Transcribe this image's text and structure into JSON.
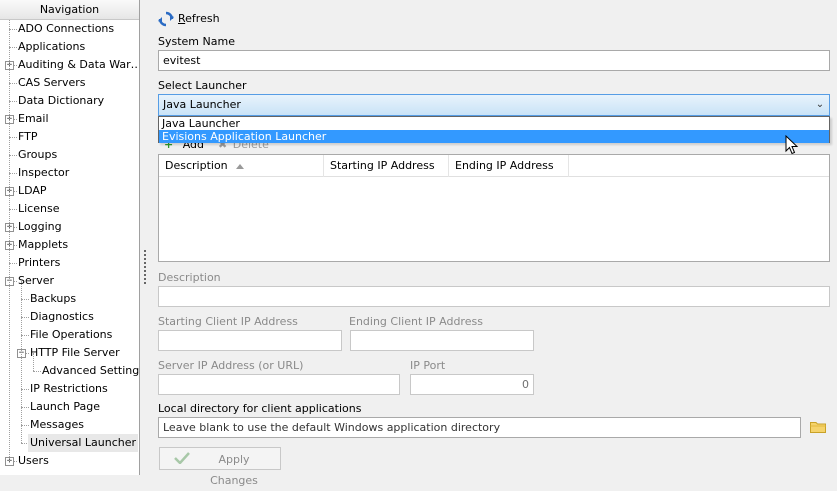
{
  "navigation": {
    "title": "Navigation",
    "items": [
      {
        "label": "ADO Connections",
        "expandable": false,
        "level": 0
      },
      {
        "label": "Applications",
        "expandable": false,
        "level": 0
      },
      {
        "label": "Auditing & Data War…",
        "expandable": true,
        "level": 0
      },
      {
        "label": "CAS Servers",
        "expandable": false,
        "level": 0
      },
      {
        "label": "Data Dictionary",
        "expandable": false,
        "level": 0
      },
      {
        "label": "Email",
        "expandable": true,
        "level": 0
      },
      {
        "label": "FTP",
        "expandable": false,
        "level": 0
      },
      {
        "label": "Groups",
        "expandable": false,
        "level": 0
      },
      {
        "label": "Inspector",
        "expandable": false,
        "level": 0
      },
      {
        "label": "LDAP",
        "expandable": true,
        "level": 0
      },
      {
        "label": "License",
        "expandable": false,
        "level": 0
      },
      {
        "label": "Logging",
        "expandable": true,
        "level": 0
      },
      {
        "label": "Mapplets",
        "expandable": true,
        "level": 0
      },
      {
        "label": "Printers",
        "expandable": false,
        "level": 0
      },
      {
        "label": "Server",
        "expandable": true,
        "expanded": true,
        "level": 0
      },
      {
        "label": "Backups",
        "expandable": false,
        "level": 1
      },
      {
        "label": "Diagnostics",
        "expandable": false,
        "level": 1
      },
      {
        "label": "File Operations",
        "expandable": false,
        "level": 1
      },
      {
        "label": "HTTP File Server",
        "expandable": true,
        "expanded": true,
        "level": 1
      },
      {
        "label": "Advanced Settings",
        "expandable": false,
        "level": 2
      },
      {
        "label": "IP Restrictions",
        "expandable": false,
        "level": 1
      },
      {
        "label": "Launch Page",
        "expandable": false,
        "level": 1
      },
      {
        "label": "Messages",
        "expandable": false,
        "level": 1
      },
      {
        "label": "Universal Launcher",
        "expandable": false,
        "level": 1,
        "selected": true
      },
      {
        "label": "Users",
        "expandable": true,
        "level": 0
      }
    ]
  },
  "toolbar": {
    "refresh_label": "Refresh",
    "refresh_icon": "refresh-icon"
  },
  "form": {
    "system_name_label": "System Name",
    "system_name_value": "evitest",
    "select_launcher_label": "Select Launcher",
    "select_launcher_value": "Java Launcher",
    "launcher_options": [
      "Java Launcher",
      "Evisions Application Launcher"
    ],
    "highlighted_option": "Evisions Application Launcher",
    "add_label": "Add",
    "delete_label": "Delete",
    "grid_columns": [
      "Description",
      "Starting IP Address",
      "Ending IP Address"
    ],
    "description_label": "Description",
    "description_value": "",
    "starting_client_ip_label": "Starting Client IP Address",
    "starting_client_ip_value": "",
    "ending_client_ip_label": "Ending Client IP Address",
    "ending_client_ip_value": "",
    "server_ip_label": "Server IP Address (or URL)",
    "server_ip_value": "",
    "ip_port_label": "IP Port",
    "ip_port_value": "0",
    "local_dir_label": "Local directory for client applications",
    "local_dir_value": "Leave blank to use the default Windows application directory",
    "apply_label": "Apply Changes"
  },
  "colors": {
    "highlight": "#3399ff",
    "combo_border": "#569de5",
    "disabled_text": "#8a8a8a"
  }
}
